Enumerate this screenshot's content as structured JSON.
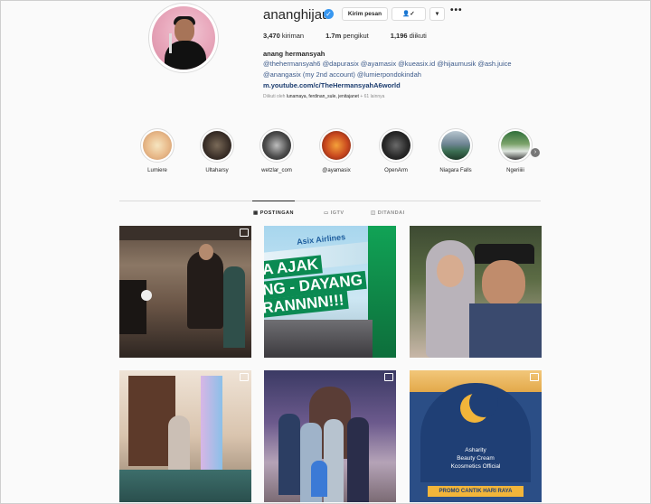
{
  "profile": {
    "username": "ananghijau",
    "message_button": "Kirim pesan",
    "follow_button_icon": "person-check-icon",
    "dropdown_icon": "chevron-down-icon",
    "more_icon": "ellipsis-icon",
    "stats": {
      "posts_value": "3,470",
      "posts_label": "kiriman",
      "followers_value": "1.7m",
      "followers_label": "pengikut",
      "following_value": "1,196",
      "following_label": "diikuti"
    },
    "bio": {
      "name": "anang hermansyah",
      "line1": "@thehermansyah6 @dapurasix @ayamasix @kueasix.id @hijaumusik @ash.juice",
      "line2": "@anangasix (my 2nd account) @lumierpondokindah",
      "link": "m.youtube.com/c/TheHermansyahA6world"
    },
    "followed_by": {
      "prefix": "Diikuti oleh",
      "names": "lunamaya, ferdinan_sule, jenitajanet",
      "suffix": "+ 61 lainnya"
    }
  },
  "highlights": [
    {
      "label": "Lumiere"
    },
    {
      "label": "Ultaharsy"
    },
    {
      "label": "wetzlar_com"
    },
    {
      "label": "@ayamasix"
    },
    {
      "label": "OpenArm"
    },
    {
      "label": "Niagara Falls"
    },
    {
      "label": "Ngeriiiii"
    }
  ],
  "tabs": [
    {
      "label": "POSTINGAN",
      "icon": "grid-icon",
      "active": true
    },
    {
      "label": "IGTV",
      "icon": "igtv-icon",
      "active": false
    },
    {
      "label": "DITANDAI",
      "icon": "tag-icon",
      "active": false
    }
  ],
  "posts": {
    "p2_brand": "Asix Airlines",
    "p2_line1": "A AJAK",
    "p2_line2": "NG - DAYANG",
    "p2_line3": "RANNNN!!!",
    "p6_line1": "Asharity",
    "p6_line2": "Beauty Cream",
    "p6_line3": "Kcosmetics Official",
    "p6_banner": "PROMO CANTIK HARI RAYA"
  },
  "colors": {
    "verified": "#3897f0",
    "link": "#3c5a8a",
    "muted": "#8e8e8e"
  }
}
